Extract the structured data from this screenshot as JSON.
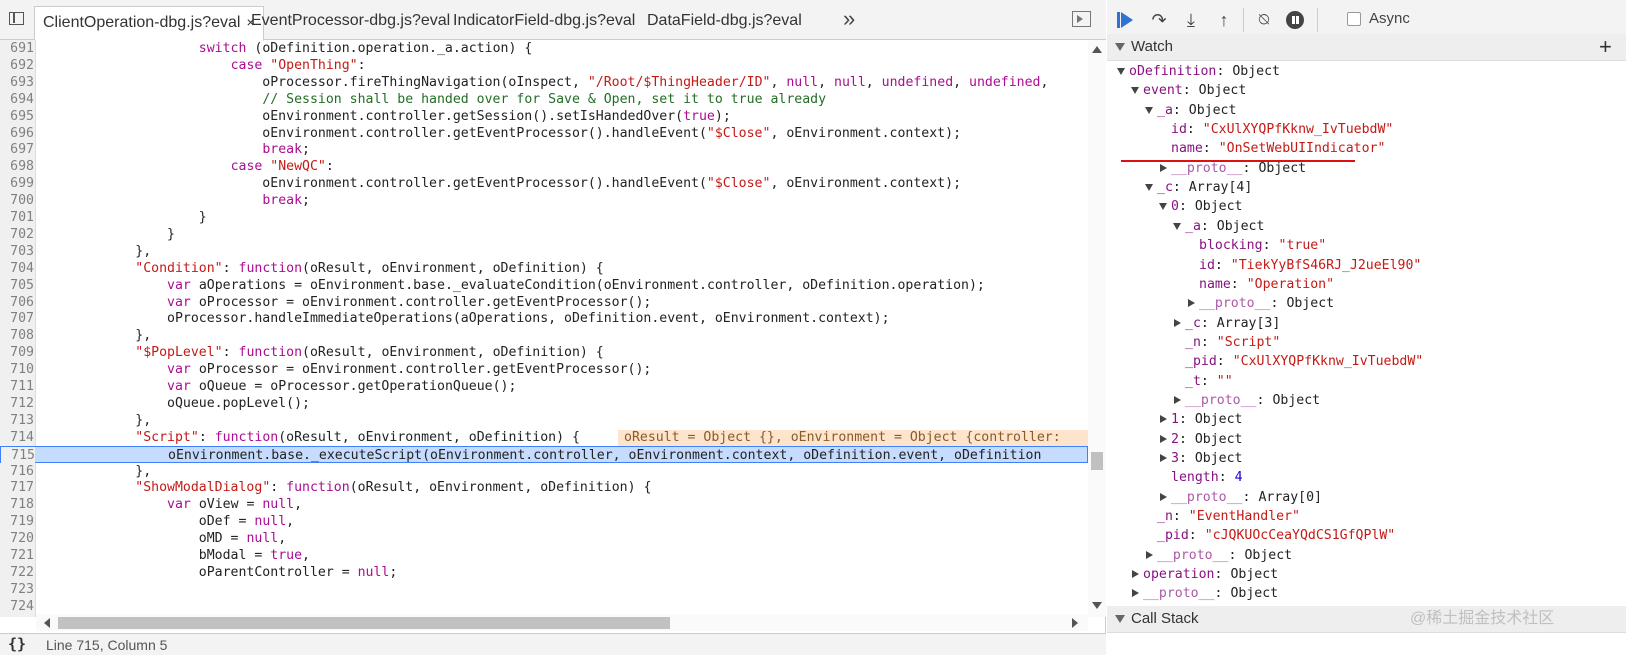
{
  "tabs": [
    {
      "label": "ClientOperation-dbg.js?eval",
      "active": true,
      "close": "×"
    },
    {
      "label": "EventProcessor-dbg.js?eval",
      "active": false
    },
    {
      "label": "IndicatorField-dbg.js?eval",
      "active": false
    },
    {
      "label": "DataField-dbg.js?eval",
      "active": false
    }
  ],
  "more_tabs": "»",
  "code_lines": [
    {
      "n": "691",
      "t": [
        [
          "",
          "                    "
        ],
        [
          "k",
          "switch"
        ],
        [
          "",
          " (oDefinition.operation._a.action) {"
        ]
      ]
    },
    {
      "n": "692",
      "t": [
        [
          "",
          "                        "
        ],
        [
          "k",
          "case"
        ],
        [
          "",
          " "
        ],
        [
          "s",
          "\"OpenThing\""
        ],
        [
          "",
          ":"
        ]
      ]
    },
    {
      "n": "693",
      "t": [
        [
          "",
          "                            oProcessor.fireThingNavigation(oInspect, "
        ],
        [
          "s",
          "\"/Root/$ThingHeader/ID\""
        ],
        [
          "",
          ", "
        ],
        [
          "k",
          "null"
        ],
        [
          "",
          ", "
        ],
        [
          "k",
          "null"
        ],
        [
          "",
          ", "
        ],
        [
          "k",
          "undefined"
        ],
        [
          "",
          ", "
        ],
        [
          "k",
          "undefined"
        ],
        [
          "",
          ","
        ]
      ]
    },
    {
      "n": "694",
      "t": [
        [
          "",
          "                            "
        ],
        [
          "c",
          "// Session shall be handed over for Save & Open, set it to true already"
        ]
      ]
    },
    {
      "n": "695",
      "t": [
        [
          "",
          "                            oEnvironment.controller.getSession().setIsHandedOver("
        ],
        [
          "k",
          "true"
        ],
        [
          "",
          ");"
        ]
      ]
    },
    {
      "n": "696",
      "t": [
        [
          "",
          "                            oEnvironment.controller.getEventProcessor().handleEvent("
        ],
        [
          "s",
          "\"$Close\""
        ],
        [
          "",
          ", oEnvironment.context);"
        ]
      ]
    },
    {
      "n": "697",
      "t": [
        [
          "",
          "                            "
        ],
        [
          "k",
          "break"
        ],
        [
          "",
          ";"
        ]
      ]
    },
    {
      "n": "698",
      "t": [
        [
          "",
          "                        "
        ],
        [
          "k",
          "case"
        ],
        [
          "",
          " "
        ],
        [
          "s",
          "\"NewQC\""
        ],
        [
          "",
          ":"
        ]
      ]
    },
    {
      "n": "699",
      "t": [
        [
          "",
          "                            oEnvironment.controller.getEventProcessor().handleEvent("
        ],
        [
          "s",
          "\"$Close\""
        ],
        [
          "",
          ", oEnvironment.context);"
        ]
      ]
    },
    {
      "n": "700",
      "t": [
        [
          "",
          "                            "
        ],
        [
          "k",
          "break"
        ],
        [
          "",
          ";"
        ]
      ]
    },
    {
      "n": "701",
      "t": [
        [
          "",
          "                    }"
        ]
      ]
    },
    {
      "n": "702",
      "t": [
        [
          "",
          "                }"
        ]
      ]
    },
    {
      "n": "703",
      "t": [
        [
          "",
          "            },"
        ]
      ]
    },
    {
      "n": "704",
      "t": [
        [
          "",
          "            "
        ],
        [
          "s",
          "\"Condition\""
        ],
        [
          "",
          ": "
        ],
        [
          "k",
          "function"
        ],
        [
          "",
          "(oResult, oEnvironment, oDefinition) {"
        ]
      ]
    },
    {
      "n": "705",
      "t": [
        [
          "",
          "                "
        ],
        [
          "k",
          "var"
        ],
        [
          "",
          " aOperations = oEnvironment.base._evaluateCondition(oEnvironment.controller, oDefinition.operation);"
        ]
      ]
    },
    {
      "n": "706",
      "t": [
        [
          "",
          "                "
        ],
        [
          "k",
          "var"
        ],
        [
          "",
          " oProcessor = oEnvironment.controller.getEventProcessor();"
        ]
      ]
    },
    {
      "n": "707",
      "t": [
        [
          "",
          "                oProcessor.handleImmediateOperations(aOperations, oDefinition.event, oEnvironment.context);"
        ]
      ]
    },
    {
      "n": "708",
      "t": [
        [
          "",
          "            },"
        ]
      ]
    },
    {
      "n": "709",
      "t": [
        [
          "",
          "            "
        ],
        [
          "s",
          "\"$PopLevel\""
        ],
        [
          "",
          ": "
        ],
        [
          "k",
          "function"
        ],
        [
          "",
          "(oResult, oEnvironment, oDefinition) {"
        ]
      ]
    },
    {
      "n": "710",
      "t": [
        [
          "",
          "                "
        ],
        [
          "k",
          "var"
        ],
        [
          "",
          " oProcessor = oEnvironment.controller.getEventProcessor();"
        ]
      ]
    },
    {
      "n": "711",
      "t": [
        [
          "",
          "                "
        ],
        [
          "k",
          "var"
        ],
        [
          "",
          " oQueue = oProcessor.getOperationQueue();"
        ]
      ]
    },
    {
      "n": "712",
      "t": [
        [
          "",
          "                oQueue.popLevel();"
        ]
      ]
    },
    {
      "n": "713",
      "t": [
        [
          "",
          "            },"
        ]
      ]
    },
    {
      "n": "714",
      "t": [
        [
          "",
          "            "
        ],
        [
          "s",
          "\"Script\""
        ],
        [
          "",
          ": "
        ],
        [
          "k",
          "function"
        ],
        [
          "",
          "(oResult, oEnvironment, oDefinition) {"
        ]
      ],
      "inline": "oResult = Object {}, oEnvironment = Object {controller:"
    },
    {
      "n": "715",
      "t": [
        [
          "",
          "                oEnvironment.base._executeScript(oEnvironment.controller, oEnvironment.context, oDefinition.event, oDefinition"
        ]
      ],
      "exec": true
    },
    {
      "n": "716",
      "t": [
        [
          "",
          "            },"
        ]
      ]
    },
    {
      "n": "717",
      "t": [
        [
          "",
          "            "
        ],
        [
          "s",
          "\"ShowModalDialog\""
        ],
        [
          "",
          ": "
        ],
        [
          "k",
          "function"
        ],
        [
          "",
          "(oResult, oEnvironment, oDefinition) {"
        ]
      ]
    },
    {
      "n": "718",
      "t": [
        [
          "",
          "                "
        ],
        [
          "k",
          "var"
        ],
        [
          "",
          " oView = "
        ],
        [
          "k",
          "null"
        ],
        [
          "",
          ","
        ]
      ]
    },
    {
      "n": "719",
      "t": [
        [
          "",
          "                    oDef = "
        ],
        [
          "k",
          "null"
        ],
        [
          "",
          ","
        ]
      ]
    },
    {
      "n": "720",
      "t": [
        [
          "",
          "                    oMD = "
        ],
        [
          "k",
          "null"
        ],
        [
          "",
          ","
        ]
      ]
    },
    {
      "n": "721",
      "t": [
        [
          "",
          "                    bModal = "
        ],
        [
          "k",
          "true"
        ],
        [
          "",
          ","
        ]
      ]
    },
    {
      "n": "722",
      "t": [
        [
          "",
          "                    oParentController = "
        ],
        [
          "k",
          "null"
        ],
        [
          "",
          ";"
        ]
      ]
    },
    {
      "n": "723",
      "t": [
        [
          "",
          ""
        ]
      ]
    },
    {
      "n": "724",
      "t": [
        [
          "",
          ""
        ]
      ]
    }
  ],
  "status": {
    "pretty_print": "{}",
    "cursor": "Line 715, Column 5"
  },
  "toolbar": {
    "async_label": "Async",
    "async_checked": false
  },
  "watch": {
    "title": "Watch",
    "add": "+",
    "tree": [
      {
        "d": 0,
        "tw": "open",
        "k": "oDefinition",
        "v": "Object",
        "vt": "obj"
      },
      {
        "d": 1,
        "tw": "open",
        "k": "event",
        "v": "Object",
        "vt": "obj"
      },
      {
        "d": 2,
        "tw": "open",
        "k": "_a",
        "v": "Object",
        "vt": "obj"
      },
      {
        "d": 3,
        "tw": "",
        "k": "id",
        "v": "\"CxUlXYQPfKknw_IvTuebdW\"",
        "vt": "str"
      },
      {
        "d": 3,
        "tw": "",
        "k": "name",
        "v": "\"OnSetWebUIIndicator\"",
        "vt": "str"
      },
      {
        "d": 3,
        "tw": "closed",
        "k": "__proto__",
        "v": "Object",
        "vt": "obj",
        "proto": true
      },
      {
        "d": 2,
        "tw": "open",
        "k": "_c",
        "v": "Array[4]",
        "vt": "obj"
      },
      {
        "d": 3,
        "tw": "open",
        "k": "0",
        "v": "Object",
        "vt": "obj"
      },
      {
        "d": 4,
        "tw": "open",
        "k": "_a",
        "v": "Object",
        "vt": "obj"
      },
      {
        "d": 5,
        "tw": "",
        "k": "blocking",
        "v": "\"true\"",
        "vt": "str"
      },
      {
        "d": 5,
        "tw": "",
        "k": "id",
        "v": "\"TiekYyBfS46RJ_J2ueEl90\"",
        "vt": "str"
      },
      {
        "d": 5,
        "tw": "",
        "k": "name",
        "v": "\"Operation\"",
        "vt": "str"
      },
      {
        "d": 5,
        "tw": "closed",
        "k": "__proto__",
        "v": "Object",
        "vt": "obj",
        "proto": true
      },
      {
        "d": 4,
        "tw": "closed",
        "k": "_c",
        "v": "Array[3]",
        "vt": "obj"
      },
      {
        "d": 4,
        "tw": "",
        "k": "_n",
        "v": "\"Script\"",
        "vt": "str"
      },
      {
        "d": 4,
        "tw": "",
        "k": "_pid",
        "v": "\"CxUlXYQPfKknw_IvTuebdW\"",
        "vt": "str"
      },
      {
        "d": 4,
        "tw": "",
        "k": "_t",
        "v": "\"\"",
        "vt": "str"
      },
      {
        "d": 4,
        "tw": "closed",
        "k": "__proto__",
        "v": "Object",
        "vt": "obj",
        "proto": true
      },
      {
        "d": 3,
        "tw": "closed",
        "k": "1",
        "v": "Object",
        "vt": "obj"
      },
      {
        "d": 3,
        "tw": "closed",
        "k": "2",
        "v": "Object",
        "vt": "obj"
      },
      {
        "d": 3,
        "tw": "closed",
        "k": "3",
        "v": "Object",
        "vt": "obj"
      },
      {
        "d": 3,
        "tw": "",
        "k": "length",
        "v": "4",
        "vt": "num"
      },
      {
        "d": 3,
        "tw": "closed",
        "k": "__proto__",
        "v": "Array[0]",
        "vt": "obj",
        "proto": true
      },
      {
        "d": 2,
        "tw": "",
        "k": "_n",
        "v": "\"EventHandler\"",
        "vt": "str"
      },
      {
        "d": 2,
        "tw": "",
        "k": "_pid",
        "v": "\"cJQKUOcCeaYQdCS1GfQPlW\"",
        "vt": "str"
      },
      {
        "d": 2,
        "tw": "closed",
        "k": "__proto__",
        "v": "Object",
        "vt": "obj",
        "proto": true
      },
      {
        "d": 1,
        "tw": "closed",
        "k": "operation",
        "v": "Object",
        "vt": "obj"
      },
      {
        "d": 1,
        "tw": "closed",
        "k": "__proto__",
        "v": "Object",
        "vt": "obj",
        "proto": true
      }
    ]
  },
  "callstack": {
    "title": "Call Stack"
  },
  "watermark": "@稀土掘金技术社区",
  "colors": {
    "keyword": "#aa0d91",
    "string": "#c41a16",
    "comment": "#236e25",
    "exec_line": "#c5dcff",
    "underline": "#dd1111"
  }
}
